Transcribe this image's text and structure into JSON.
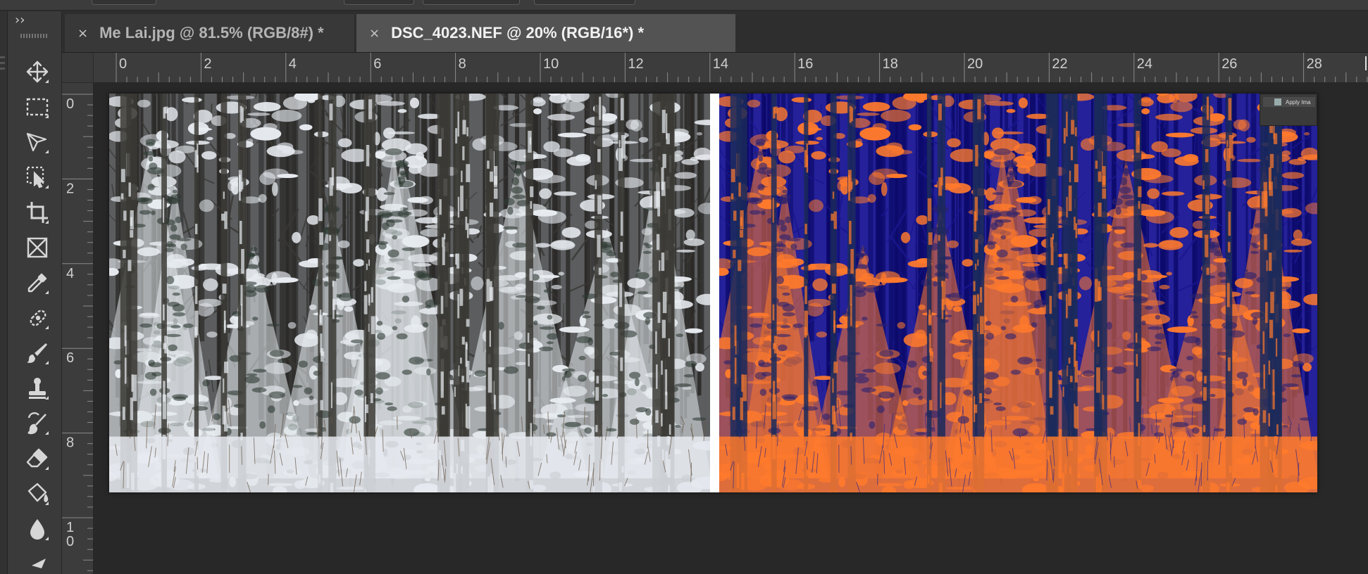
{
  "app": {
    "theme_colors": {
      "panel": "#3a3a3a",
      "canvas": "#282828",
      "active_tab": "#535353"
    }
  },
  "toolbar": {
    "collapse_glyph": "››",
    "tools": [
      {
        "name": "move-tool-icon"
      },
      {
        "name": "rectangular-marquee-icon"
      },
      {
        "name": "lasso-tool-icon"
      },
      {
        "name": "object-selection-icon"
      },
      {
        "name": "crop-tool-icon"
      },
      {
        "name": "frame-tool-icon"
      },
      {
        "name": "eyedropper-icon"
      },
      {
        "name": "spot-healing-icon"
      },
      {
        "name": "brush-tool-icon"
      },
      {
        "name": "clone-stamp-icon"
      },
      {
        "name": "history-brush-icon"
      },
      {
        "name": "eraser-icon"
      },
      {
        "name": "paint-bucket-icon"
      },
      {
        "name": "blur-tool-icon"
      }
    ]
  },
  "tabs": [
    {
      "close": "×",
      "label": "Me Lai.jpg @ 81.5% (RGB/8#) *",
      "active": false
    },
    {
      "close": "×",
      "label": "DSC_4023.NEF @ 20% (RGB/16*) *",
      "active": true
    }
  ],
  "rulers": {
    "horizontal": [
      "0",
      "2",
      "4",
      "6",
      "8",
      "10",
      "12",
      "14",
      "16",
      "18",
      "20",
      "22",
      "24",
      "26",
      "28"
    ],
    "vertical": [
      "0",
      "2",
      "4",
      "6",
      "8",
      "1\n0"
    ]
  },
  "document": {
    "embedded_panel_label": "Apply Ima"
  }
}
